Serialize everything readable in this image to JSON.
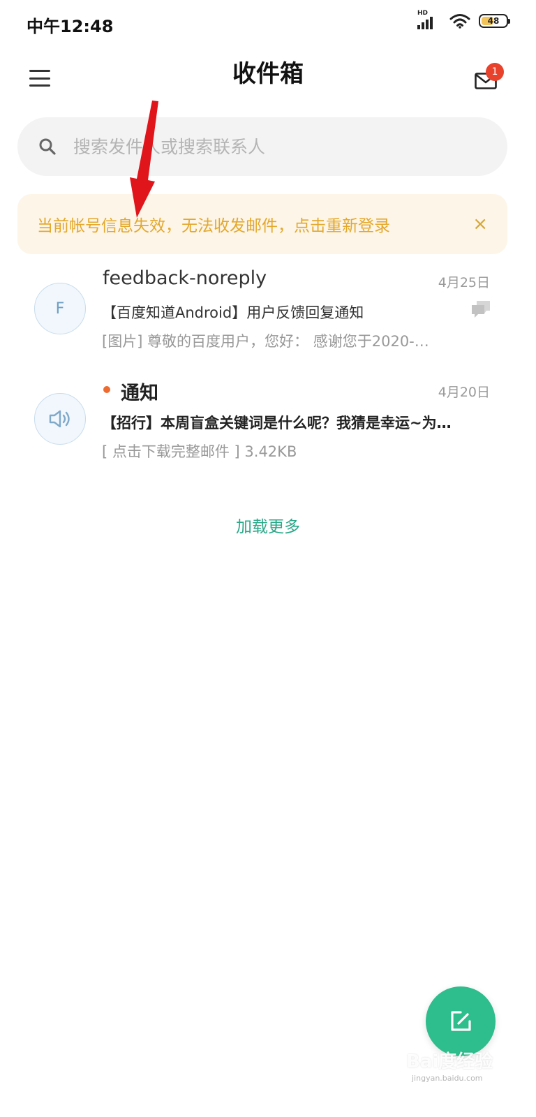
{
  "status_bar": {
    "time": "中午12:48",
    "network_label": "HD",
    "battery_percent": "48"
  },
  "header": {
    "title": "收件箱",
    "mail_badge_count": "1"
  },
  "search": {
    "placeholder": "搜索发件人或搜索联系人"
  },
  "banner": {
    "text": "当前帐号信息失效，无法收发邮件，点击重新登录",
    "close_symbol": "×",
    "text_color": "#e3a82c",
    "background_color": "#fdf5e8"
  },
  "mails": [
    {
      "avatar_letter": "F",
      "sender": "feedback-noreply",
      "date": "4月25日",
      "subject": "【百度知道Android】用户反馈回复通知",
      "preview": "[图片] 尊敬的百度用户，您好： 感谢您于2020-…",
      "unread": false,
      "avatar_icon": "user-letter-avatar",
      "has_thread_icon": true
    },
    {
      "avatar_letter": "",
      "sender": "通知",
      "date": "4月20日",
      "subject": "【招行】本周盲盒关键词是什么呢？我猜是幸运~为…",
      "preview": "[ 点击下载完整邮件 ] 3.42KB",
      "unread": true,
      "avatar_icon": "speaker-icon",
      "has_thread_icon": false
    }
  ],
  "load_more": "加载更多",
  "fab": {
    "icon": "compose-icon",
    "color": "#2ebd8c"
  },
  "watermark": {
    "brand": "Bai度经验",
    "url": "jingyan.baidu.com"
  },
  "colors": {
    "accent_green": "#2aa888",
    "unread_dot": "#ef6a2f",
    "badge_red": "#e8412c",
    "annotation_arrow": "#e0141b"
  }
}
